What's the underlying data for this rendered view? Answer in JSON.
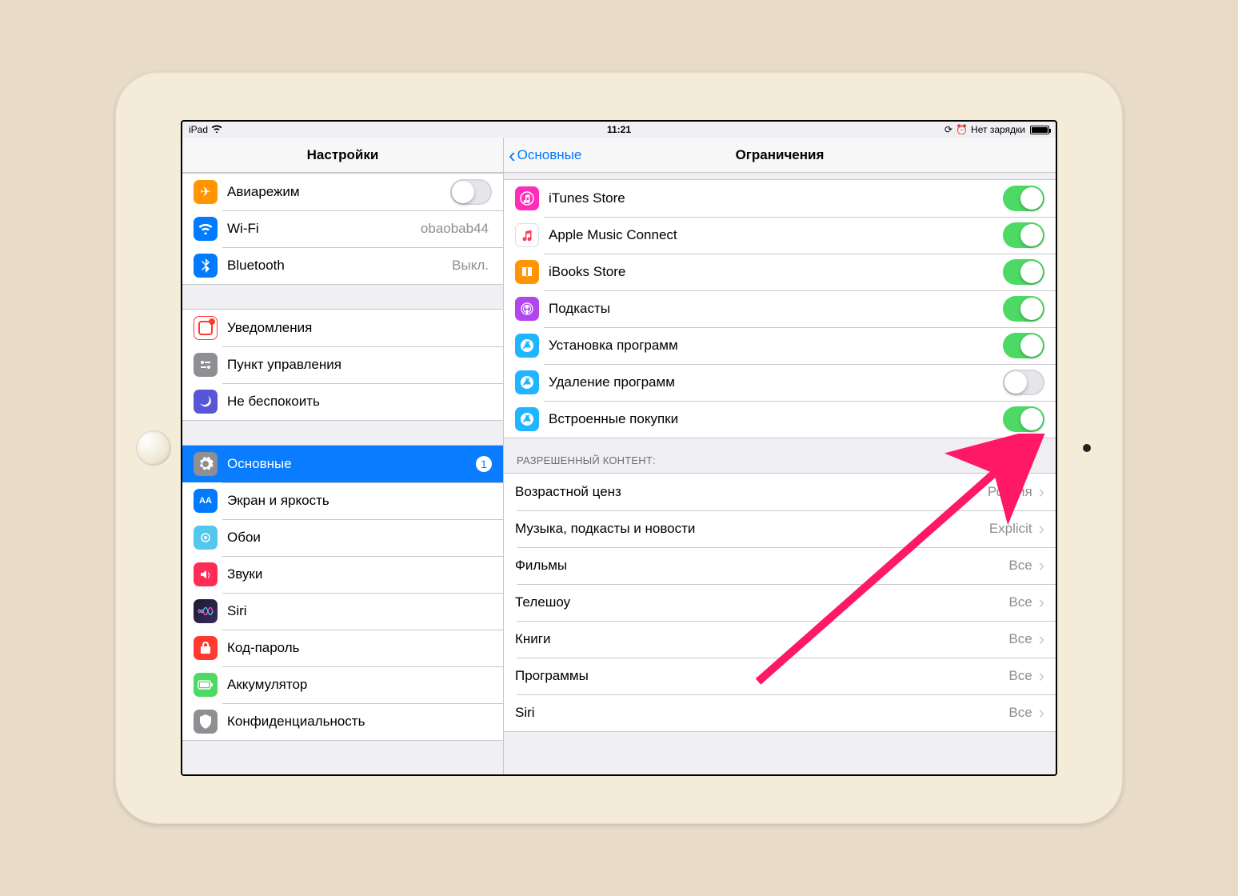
{
  "status": {
    "left_device": "iPad",
    "time": "11:21",
    "battery_text": "Нет зарядки"
  },
  "left": {
    "title": "Настройки",
    "group1": {
      "airplane": {
        "label": "Авиарежим",
        "on": false
      },
      "wifi": {
        "label": "Wi-Fi",
        "detail": "obaobab44"
      },
      "bluetooth": {
        "label": "Bluetooth",
        "detail": "Выкл."
      }
    },
    "group2": {
      "notifications": {
        "label": "Уведомления"
      },
      "controlcenter": {
        "label": "Пункт управления"
      },
      "dnd": {
        "label": "Не беспокоить"
      }
    },
    "group3": {
      "general": {
        "label": "Основные",
        "badge": "1"
      },
      "display": {
        "label": "Экран и яркость"
      },
      "wallpaper": {
        "label": "Обои"
      },
      "sounds": {
        "label": "Звуки"
      },
      "siri": {
        "label": "Siri"
      },
      "passcode": {
        "label": "Код-пароль"
      },
      "battery": {
        "label": "Аккумулятор"
      },
      "privacy": {
        "label": "Конфиденциальность"
      }
    }
  },
  "right": {
    "back_label": "Основные",
    "title": "Ограничения",
    "toggles": [
      {
        "label": "iTunes Store",
        "on": true,
        "icon": "itunes",
        "bg": "#ff2db9"
      },
      {
        "label": "Apple Music Connect",
        "on": true,
        "icon": "music",
        "bg": "#ffffff"
      },
      {
        "label": "iBooks Store",
        "on": true,
        "icon": "ibooks",
        "bg": "#ff9500"
      },
      {
        "label": "Подкасты",
        "on": true,
        "icon": "podcasts",
        "bg": "#b146ec"
      },
      {
        "label": "Установка программ",
        "on": true,
        "icon": "appstore",
        "bg": "#1fb6ff"
      },
      {
        "label": "Удаление программ",
        "on": false,
        "icon": "appstore",
        "bg": "#1fb6ff"
      },
      {
        "label": "Встроенные покупки",
        "on": true,
        "icon": "appstore",
        "bg": "#1fb6ff"
      }
    ],
    "content_header": "РАЗРЕШЕННЫЙ КОНТЕНТ:",
    "content_rows": [
      {
        "label": "Возрастной ценз",
        "detail": "Россия"
      },
      {
        "label": "Музыка, подкасты и новости",
        "detail": "Explicit"
      },
      {
        "label": "Фильмы",
        "detail": "Все"
      },
      {
        "label": "Телешоу",
        "detail": "Все"
      },
      {
        "label": "Книги",
        "detail": "Все"
      },
      {
        "label": "Программы",
        "detail": "Все"
      },
      {
        "label": "Siri",
        "detail": "Все"
      }
    ]
  },
  "icons": {
    "airplane_bg": "#ff9500",
    "wifi_bg": "#007aff",
    "bt_bg": "#007aff",
    "notif_bg": "#ff3b30",
    "cc_bg": "#8e8e93",
    "dnd_bg": "#5856d6",
    "general_bg": "#8e8e93",
    "display_bg": "#007aff",
    "wallpaper_bg": "#54c7ec",
    "sounds_bg": "#ff2d55",
    "siri_bg": "#000000",
    "passcode_bg": "#ff3b30",
    "battery_bg": "#4cd964",
    "privacy_bg": "#8e8e93"
  }
}
